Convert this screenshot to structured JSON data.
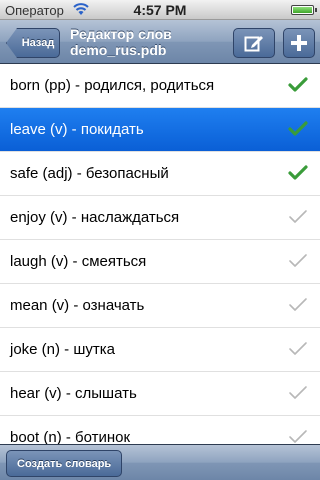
{
  "status_bar": {
    "carrier": "Оператор",
    "time": "4:57 PM"
  },
  "nav_bar": {
    "back_label": "Назад",
    "title_line1": "Редактор слов",
    "title_line2": "demo_rus.pdb"
  },
  "list": {
    "items": [
      {
        "label": "born (pp) - родился, родиться",
        "checked": true,
        "selected": false
      },
      {
        "label": "leave (v) - покидать",
        "checked": true,
        "selected": true
      },
      {
        "label": "safe (adj) - безопасный",
        "checked": true,
        "selected": false
      },
      {
        "label": "enjoy (v) - наслаждаться",
        "checked": false,
        "selected": false
      },
      {
        "label": "laugh (v) - смеяться",
        "checked": false,
        "selected": false
      },
      {
        "label": "mean (v) - означать",
        "checked": false,
        "selected": false
      },
      {
        "label": "joke (n) - шутка",
        "checked": false,
        "selected": false
      },
      {
        "label": "hear (v) - слышать",
        "checked": false,
        "selected": false
      },
      {
        "label": "boot (n) - ботинок",
        "checked": false,
        "selected": false
      }
    ]
  },
  "toolbar": {
    "create_label": "Создать словарь"
  },
  "colors": {
    "nav_blue": "#6d86a8",
    "selection_blue": "#0a5fd6",
    "check_green": "#3a9c3a",
    "check_gray": "#b8b8b8"
  }
}
